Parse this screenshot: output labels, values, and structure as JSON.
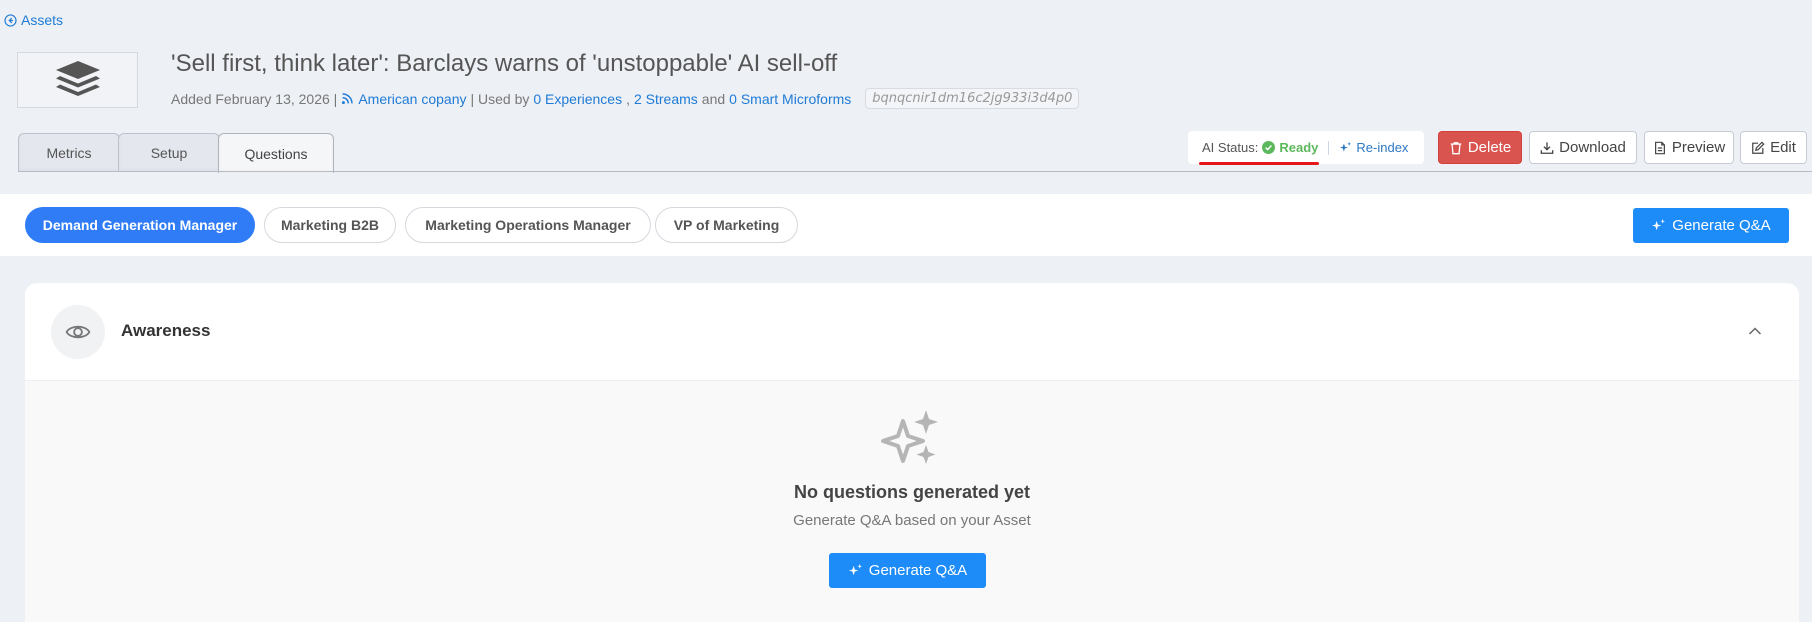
{
  "nav": {
    "back_label": "Assets"
  },
  "asset": {
    "title": "'Sell first, think later': Barclays warns of 'unstoppable' AI sell-off",
    "added": "Added February 13, 2026 |",
    "source_name": "American copany",
    "used_by_prefix": "| Used by",
    "experiences": "0 Experiences",
    "comma": ",",
    "streams": "2 Streams",
    "and": "and",
    "microforms": "0 Smart Microforms",
    "asset_id": "bqnqcnir1dm16c2jg933i3d4p0"
  },
  "tabs": [
    {
      "label": "Metrics"
    },
    {
      "label": "Setup"
    },
    {
      "label": "Questions"
    }
  ],
  "ai_status": {
    "label": "AI Status:",
    "value": "Ready",
    "reindex_label": "Re-index"
  },
  "actions": {
    "delete_label": "Delete",
    "download_label": "Download",
    "preview_label": "Preview",
    "edit_label": "Edit"
  },
  "personas": [
    {
      "label": "Demand Generation Manager"
    },
    {
      "label": "Marketing B2B"
    },
    {
      "label": "Marketing Operations Manager"
    },
    {
      "label": "VP of Marketing"
    }
  ],
  "generate_label": "Generate Q&A",
  "stage": {
    "title": "Awareness",
    "empty_title": "No questions generated yet",
    "empty_subtitle": "Generate Q&A based on your Asset",
    "generate_label": "Generate Q&A"
  },
  "colors": {
    "primary": "#1d8cf8",
    "active_pill": "#2f7cf6",
    "ready": "#5cb85c",
    "delete": "#d9534f",
    "highlight": "#e4161b"
  }
}
